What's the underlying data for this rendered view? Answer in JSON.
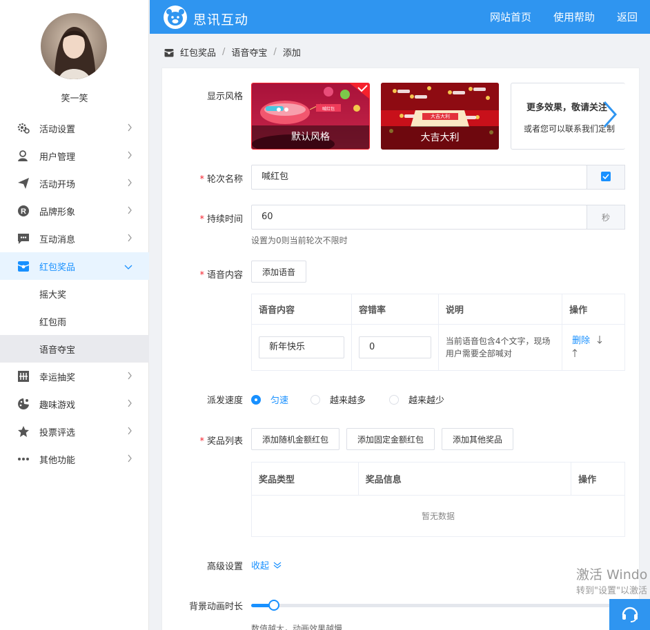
{
  "app": {
    "brand_name": "思讯互动",
    "nav": [
      "网站首页",
      "使用帮助",
      "返回"
    ]
  },
  "user": {
    "name": "笑一笑"
  },
  "sidebar": {
    "items": [
      {
        "label": "活动设置",
        "icon": "gear-icon"
      },
      {
        "label": "用户管理",
        "icon": "user-icon"
      },
      {
        "label": "活动开场",
        "icon": "paper-plane-icon"
      },
      {
        "label": "品牌形象",
        "icon": "registered-icon"
      },
      {
        "label": "互动消息",
        "icon": "chat-icon"
      },
      {
        "label": "红包奖品",
        "icon": "gift-icon",
        "active": true
      },
      {
        "label": "幸运抽奖",
        "icon": "lottery-icon"
      },
      {
        "label": "趣味游戏",
        "icon": "game-icon"
      },
      {
        "label": "投票评选",
        "icon": "star-icon"
      },
      {
        "label": "其他功能",
        "icon": "more-icon"
      }
    ],
    "sub_items": [
      "摇大奖",
      "红包雨",
      "语音夺宝"
    ],
    "selected_sub": "语音夺宝"
  },
  "breadcrumb": [
    "红包奖品",
    "语音夺宝",
    "添加"
  ],
  "form": {
    "style": {
      "label": "显示风格",
      "options": [
        "默认风格",
        "大吉大利"
      ],
      "more_title": "更多效果，敬请关注",
      "more_desc": "或者您可以联系我们定制",
      "banner_text": "喊红包",
      "stage_text": "大吉大利"
    },
    "round_name": {
      "label": "轮次名称",
      "value": "喊红包"
    },
    "duration": {
      "label": "持续时间",
      "value": "60",
      "unit": "秒",
      "hint": "设置为0则当前轮次不限时"
    },
    "voice": {
      "label": "语音内容",
      "add_button": "添加语音",
      "columns": [
        "语音内容",
        "容错率",
        "说明",
        "操作"
      ],
      "rows": [
        {
          "content": "新年快乐",
          "tolerance": "0",
          "desc_line1": "当前语音包含4个文字，现场",
          "desc_line2": "用户需要全部喊对",
          "action": "删除"
        }
      ]
    },
    "speed": {
      "label": "派发速度",
      "options": [
        "匀速",
        "越来越多",
        "越来越少"
      ],
      "selected": "匀速"
    },
    "prizes": {
      "label": "奖品列表",
      "buttons": [
        "添加随机金额红包",
        "添加固定金额红包",
        "添加其他奖品"
      ],
      "columns": [
        "奖品类型",
        "奖品信息",
        "操作"
      ],
      "empty": "暂无数据"
    },
    "advanced": {
      "label": "高级设置",
      "toggle": "收起"
    },
    "bg_anim": {
      "label": "背景动画时长",
      "hint": "数值越大，动画效果越慢",
      "value": 0.06
    }
  },
  "watermark": {
    "line1": "激活 Windo",
    "line2": "转到\"设置\"以激活"
  },
  "colors": {
    "primary": "#2f95f0",
    "accent": "#1890ff",
    "required": "#f5222d"
  }
}
